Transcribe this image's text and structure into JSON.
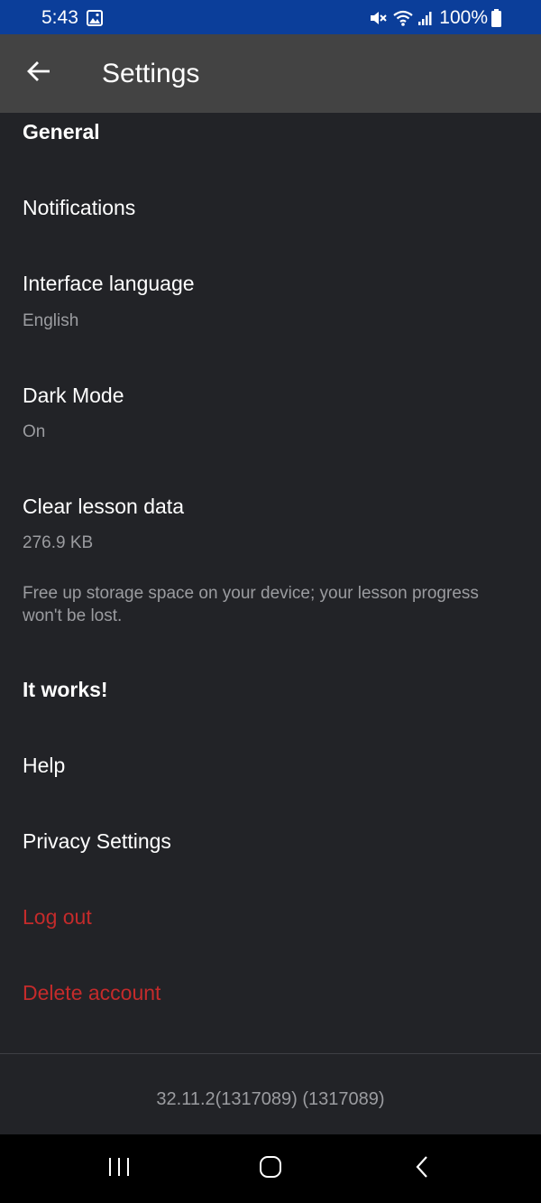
{
  "status_bar": {
    "time": "5:43",
    "battery_percent": "100%",
    "icons": [
      "gallery-icon",
      "mute-icon",
      "wifi-icon",
      "signal-icon",
      "battery-icon"
    ]
  },
  "app_bar": {
    "title": "Settings",
    "back_icon": "back-arrow-icon"
  },
  "sections": {
    "general": {
      "header": "General",
      "notifications": {
        "title": "Notifications"
      },
      "interface_language": {
        "title": "Interface language",
        "value": "English"
      },
      "dark_mode": {
        "title": "Dark Mode",
        "value": "On"
      },
      "clear_lesson_data": {
        "title": "Clear lesson data",
        "size": "276.9 KB",
        "description": "Free up storage space on your device; your lesson progress won't be lost."
      }
    },
    "it_works": {
      "header": "It works!",
      "help": {
        "title": "Help"
      },
      "privacy_settings": {
        "title": "Privacy Settings"
      },
      "log_out": {
        "title": "Log out"
      },
      "delete_account": {
        "title": "Delete account"
      }
    }
  },
  "footer": {
    "version": "32.11.2(1317089) (1317089)"
  },
  "nav_bar": {
    "recents_icon": "recents-icon",
    "home_icon": "home-icon",
    "back_icon": "nav-back-icon"
  },
  "colors": {
    "status_bar_bg": "#0b3e9a",
    "app_bar_bg": "#434343",
    "background": "#222327",
    "primary_text": "#ffffff",
    "secondary_text": "#9b9ca0",
    "danger_text": "#c42b2b"
  }
}
